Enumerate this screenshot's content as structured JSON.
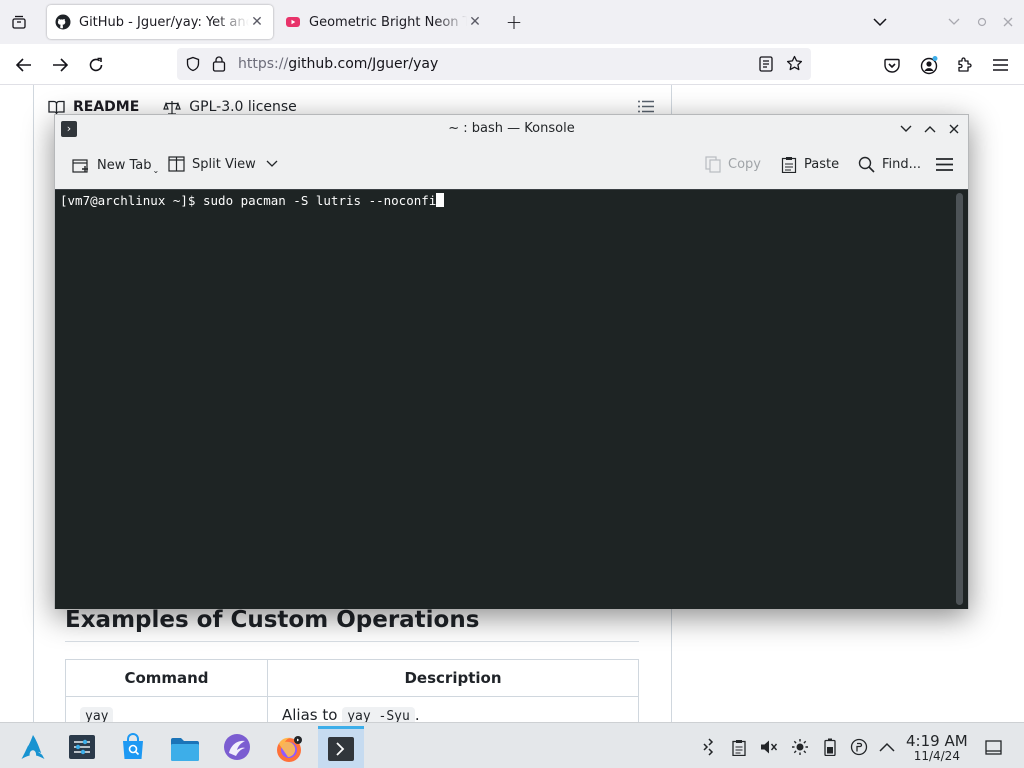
{
  "browser": {
    "tabs": [
      {
        "title": "GitHub - Jguer/yay: Yet another Yogurt",
        "active": true
      },
      {
        "title": "Geometric Bright Neon Triangles",
        "active": false
      }
    ],
    "url_scheme": "https://",
    "url_rest": "github.com/Jguer/yay"
  },
  "page": {
    "readme_label": "README",
    "license_label": "GPL-3.0 license",
    "section_heading": "Examples of Custom Operations",
    "table": {
      "headers": [
        "Command",
        "Description"
      ],
      "rows": [
        {
          "command": "yay",
          "desc_prefix": "Alias to",
          "desc_code": "yay -Syu",
          "desc_suffix": "."
        }
      ]
    }
  },
  "konsole": {
    "title": "~ : bash — Konsole",
    "toolbar": {
      "new_tab": "New Tab",
      "split_view": "Split View",
      "copy": "Copy",
      "paste": "Paste",
      "find": "Find..."
    },
    "prompt": "[vm7@archlinux ~]$ ",
    "command": "sudo pacman -S lutris --noconfi"
  },
  "taskbar": {
    "time": "4:19 AM",
    "date": "11/4/24"
  },
  "colors": {
    "accent": "#3daee9",
    "terminal_bg": "#1e2424",
    "terminal_fg": "#fcfcfc"
  }
}
